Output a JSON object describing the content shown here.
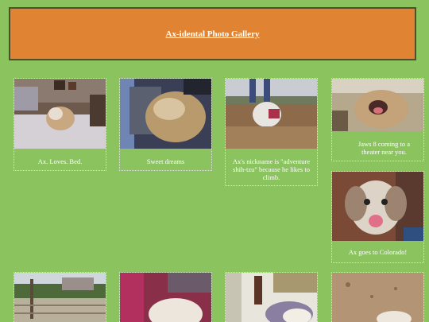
{
  "header": {
    "title": "Ax-idental Photo Gallery"
  },
  "gallery": {
    "items": [
      {
        "caption": "Ax. Loves. Bed.",
        "alt": "dog on bed"
      },
      {
        "caption": "Sweet dreams",
        "alt": "dog sleeping"
      },
      {
        "caption": "Ax's nickname is \"adventure shih-tzu\" because he likes to climb.",
        "alt": "dog outdoors"
      },
      {
        "caption": "Jaws 8 coming to a theater near you.",
        "alt": "dog yawning"
      },
      {
        "caption": "Ax goes to Colorado!",
        "alt": "happy dog"
      },
      {
        "caption": "",
        "alt": "park scene"
      },
      {
        "caption": "",
        "alt": "dog on red blanket"
      },
      {
        "caption": "",
        "alt": "dog indoors"
      },
      {
        "caption": "",
        "alt": "dog on dirt"
      }
    ]
  }
}
